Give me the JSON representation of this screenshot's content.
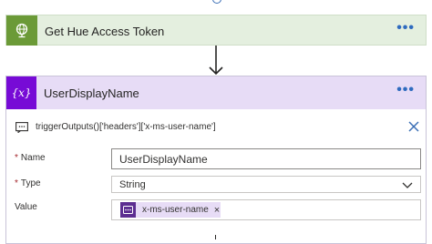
{
  "flow": {
    "previous_action": {
      "title": "Get Hue Access Token",
      "icon": "globe-icon",
      "menu": "•••",
      "color": "#6b9a37"
    },
    "variable_action": {
      "title": "UserDisplayName",
      "icon": "variable-icon",
      "icon_text": "{x}",
      "menu": "•••",
      "color": "#770bd6",
      "peek_expression": "triggerOutputs()['headers']['x-ms-user-name']",
      "fields": {
        "name": {
          "label": "Name",
          "required": "*",
          "value": "UserDisplayName"
        },
        "type": {
          "label": "Type",
          "required": "*",
          "value": "String"
        },
        "value": {
          "label": "Value",
          "token_label": "x-ms-user-name",
          "token_remove": "×"
        }
      }
    }
  }
}
